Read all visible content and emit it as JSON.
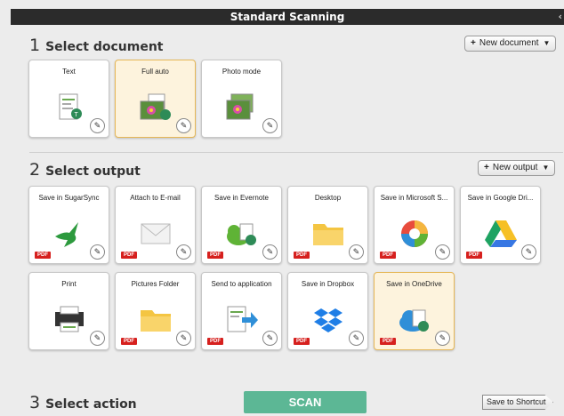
{
  "window": {
    "title": "Standard Scanning"
  },
  "section1": {
    "number": "1",
    "title": "Select document",
    "new_button": "New document",
    "cards": [
      {
        "label": "Text",
        "icon": "text-document-icon",
        "selected": false
      },
      {
        "label": "Full auto",
        "icon": "full-auto-photo-icon",
        "selected": true
      },
      {
        "label": "Photo mode",
        "icon": "photo-mode-icon",
        "selected": false
      }
    ]
  },
  "section2": {
    "number": "2",
    "title": "Select output",
    "new_button": "New output",
    "cards": [
      {
        "label": "Save in SugarSync",
        "icon": "sugarsync-hummingbird-icon",
        "pdf": "PDF",
        "selected": false
      },
      {
        "label": "Attach to E-mail",
        "icon": "envelope-icon",
        "pdf": "PDF",
        "selected": false
      },
      {
        "label": "Save in Evernote",
        "icon": "evernote-icon",
        "pdf": "PDF",
        "selected": false
      },
      {
        "label": "Desktop",
        "icon": "folder-icon",
        "pdf": "PDF",
        "selected": false
      },
      {
        "label": "Save in Microsoft S...",
        "icon": "microsoft-sharepoint-icon",
        "pdf": "PDF",
        "selected": false
      },
      {
        "label": "Save in Google Dri...",
        "icon": "google-drive-icon",
        "pdf": "PDF",
        "selected": false
      },
      {
        "label": "Print",
        "icon": "printer-icon",
        "pdf": "",
        "selected": false
      },
      {
        "label": "Pictures Folder",
        "icon": "folder-icon",
        "pdf": "PDF",
        "selected": false
      },
      {
        "label": "Send to application",
        "icon": "send-to-application-icon",
        "pdf": "PDF",
        "selected": false
      },
      {
        "label": "Save in Dropbox",
        "icon": "dropbox-icon",
        "pdf": "PDF",
        "selected": false
      },
      {
        "label": "Save in OneDrive",
        "icon": "onedrive-icon",
        "pdf": "PDF",
        "selected": true
      }
    ]
  },
  "section3": {
    "number": "3",
    "title": "Select action",
    "scan_button": "SCAN",
    "shortcut_button": "Save to Shortcut"
  },
  "colors": {
    "scan": "#5cb795",
    "selected_bg": "#fdf3dd",
    "selected_border": "#e6b757",
    "pdf_badge": "#d6201e"
  }
}
